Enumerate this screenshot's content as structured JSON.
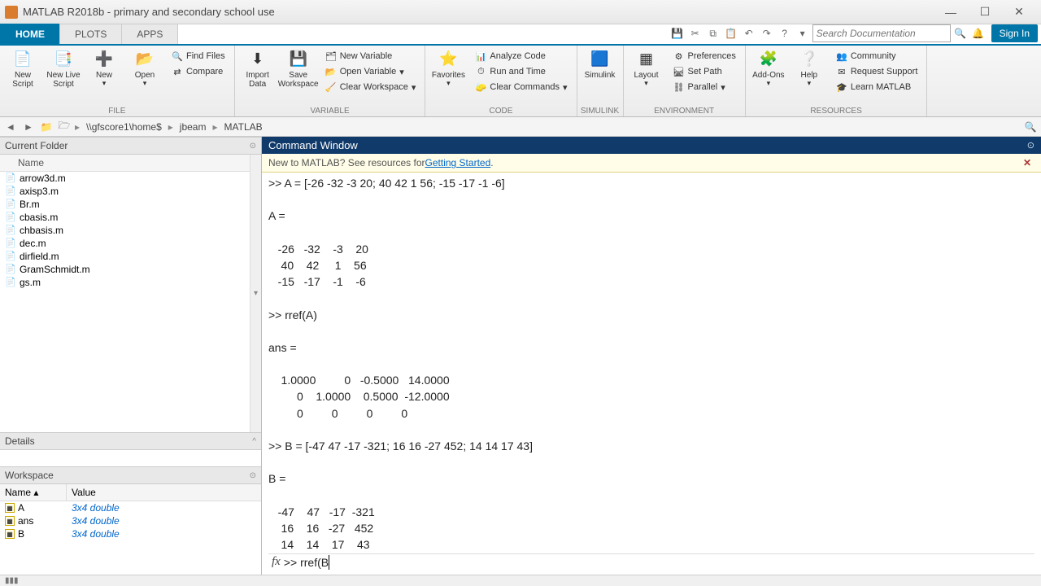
{
  "window": {
    "title": "MATLAB R2018b - primary and secondary school use"
  },
  "tabs": {
    "t0": "HOME",
    "t1": "PLOTS",
    "t2": "APPS"
  },
  "toolbar": {
    "search_placeholder": "Search Documentation",
    "signin": "Sign In"
  },
  "ribbon": {
    "file": {
      "new_script": "New\nScript",
      "new_live_script": "New\nLive Script",
      "new": "New",
      "open": "Open",
      "find_files": "Find Files",
      "compare": "Compare",
      "label": "FILE"
    },
    "variable": {
      "import_data": "Import\nData",
      "save_workspace": "Save\nWorkspace",
      "new_var": "New Variable",
      "open_var": "Open Variable",
      "clear_ws": "Clear Workspace",
      "label": "VARIABLE"
    },
    "code": {
      "favorites": "Favorites",
      "analyze": "Analyze Code",
      "run_time": "Run and Time",
      "clear_cmd": "Clear Commands",
      "label": "CODE"
    },
    "simulink": {
      "btn": "Simulink",
      "label": "SIMULINK"
    },
    "environment": {
      "layout": "Layout",
      "prefs": "Preferences",
      "set_path": "Set Path",
      "parallel": "Parallel",
      "label": "ENVIRONMENT"
    },
    "resources": {
      "addons": "Add-Ons",
      "help": "Help",
      "community": "Community",
      "req_support": "Request Support",
      "learn": "Learn MATLAB",
      "label": "RESOURCES"
    }
  },
  "path": {
    "root": "\\\\gfscore1\\home$",
    "p1": "jbeam",
    "p2": "MATLAB"
  },
  "current_folder": {
    "title": "Current Folder",
    "col_name": "Name",
    "files": [
      "arrow3d.m",
      "axisp3.m",
      "Br.m",
      "cbasis.m",
      "chbasis.m",
      "dec.m",
      "dirfield.m",
      "GramSchmidt.m",
      "gs.m"
    ]
  },
  "details": {
    "title": "Details"
  },
  "workspace": {
    "title": "Workspace",
    "col_name": "Name ▴",
    "col_value": "Value",
    "rows": [
      {
        "name": "A",
        "value": "3x4 double"
      },
      {
        "name": "ans",
        "value": "3x4 double"
      },
      {
        "name": "B",
        "value": "3x4 double"
      }
    ]
  },
  "cmdwin": {
    "title": "Command Window",
    "banner_pre": "New to MATLAB? See resources for ",
    "banner_link": "Getting Started",
    "output": ">> A = [-26 -32 -3 20; 40 42 1 56; -15 -17 -1 -6]\n\nA =\n\n   -26   -32    -3    20\n    40    42     1    56\n   -15   -17    -1    -6\n\n>> rref(A)\n\nans =\n\n    1.0000         0   -0.5000   14.0000\n         0    1.0000    0.5000  -12.0000\n         0         0         0         0\n\n>> B = [-47 47 -17 -321; 16 16 -27 452; 14 14 17 43]\n\nB =\n\n   -47    47   -17  -321\n    16    16   -27   452\n    14    14    17    43\n",
    "prompt_prefix": ">> ",
    "prompt_value": "rref(B"
  },
  "chart_data": {
    "type": "table",
    "matrices": {
      "A": [
        [
          -26,
          -32,
          -3,
          20
        ],
        [
          40,
          42,
          1,
          56
        ],
        [
          -15,
          -17,
          -1,
          -6
        ]
      ],
      "rref_A": [
        [
          1.0,
          0,
          -0.5,
          14.0
        ],
        [
          0,
          1.0,
          0.5,
          -12.0
        ],
        [
          0,
          0,
          0,
          0
        ]
      ],
      "B": [
        [
          -47,
          47,
          -17,
          -321
        ],
        [
          16,
          16,
          -27,
          452
        ],
        [
          14,
          14,
          17,
          43
        ]
      ]
    }
  }
}
